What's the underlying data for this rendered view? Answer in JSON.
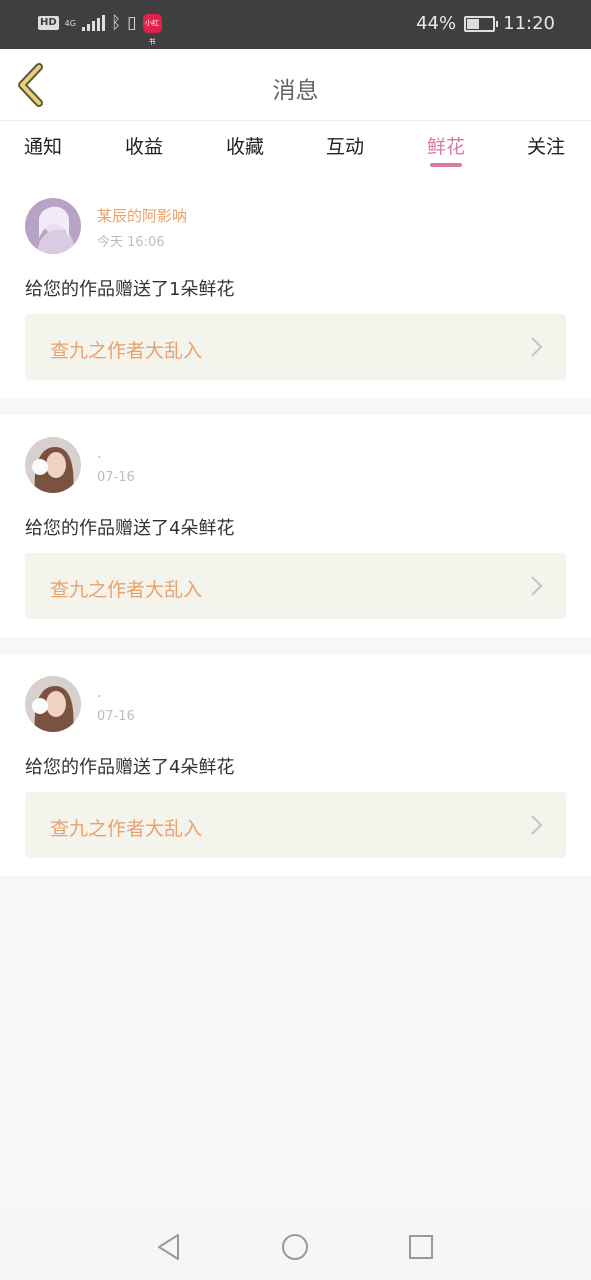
{
  "status_bar": {
    "hd": "HD",
    "network": "4G",
    "battery": "44%",
    "battery_level": 0.44,
    "time": "11:20",
    "app_badge": "小红书"
  },
  "header": {
    "title": "消息",
    "back_icon": "back-chevron-icon"
  },
  "tabs": [
    {
      "label": "通知",
      "active": false
    },
    {
      "label": "收益",
      "active": false
    },
    {
      "label": "收藏",
      "active": false
    },
    {
      "label": "互动",
      "active": false
    },
    {
      "label": "鲜花",
      "active": true
    },
    {
      "label": "关注",
      "active": false
    }
  ],
  "messages": [
    {
      "user": "某辰的阿影呐",
      "time": "今天 16:06",
      "text": "给您的作品赠送了1朵鲜花",
      "work": "查九之作者大乱入"
    },
    {
      "user": ".",
      "time": "07-16",
      "text": "给您的作品赠送了4朵鲜花",
      "work": "查九之作者大乱入"
    },
    {
      "user": ".",
      "time": "07-16",
      "text": "给您的作品赠送了4朵鲜花",
      "work": "查九之作者大乱入"
    }
  ],
  "colors": {
    "accent": "#d77ba6",
    "username": "#e8a26e",
    "work_card_bg": "#f4f4ec",
    "back_icon": "#c9a93d"
  }
}
